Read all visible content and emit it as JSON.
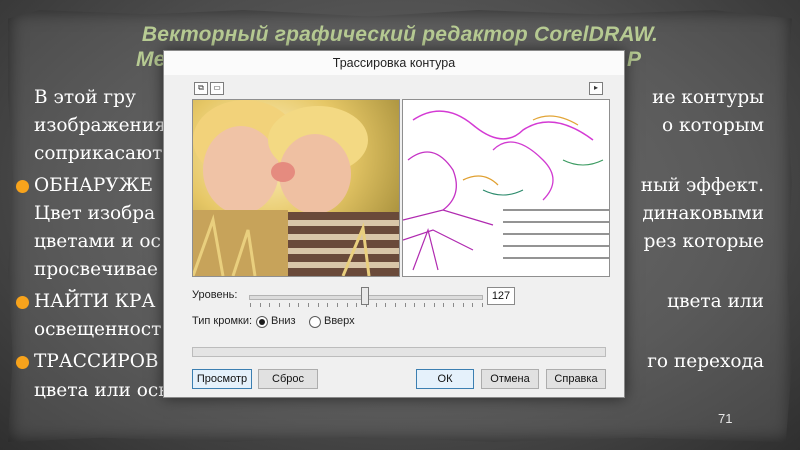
{
  "slide": {
    "title_line1": "Векторный графический редактор CorelDRAW.",
    "title_line2": "Ме",
    "title_line2_right": "Р",
    "page_number": "71",
    "body_lines": [
      {
        "left": "В  этой  гру",
        "right": "ие  контуры"
      },
      {
        "left": "изображения",
        "right": "о  которым"
      },
      {
        "left": "соприкасаютс",
        "right": ""
      },
      {
        "left": "ОБНАРУЖЕ",
        "right": "ный  эффект."
      },
      {
        "left": "Цвет изобра",
        "right": "динаковыми"
      },
      {
        "left": "цветами и ос",
        "right": "рез  которые"
      },
      {
        "left": "просвечивае",
        "right": ""
      },
      {
        "left": "НАЙТИ  КРА",
        "right": "цвета  или"
      },
      {
        "left": "освещенност",
        "right": ""
      },
      {
        "left": "ТРАССИРОВ",
        "right": "го  перехода"
      },
      {
        "left": "цвета или осв",
        "right": ""
      }
    ],
    "colors": {
      "title": "#b7cb93",
      "bullet": "#f7a31c",
      "text": "#ffffff"
    }
  },
  "dialog": {
    "title": "Трассировка контура",
    "level_label": "Уровень:",
    "level_value": "127",
    "level_fraction": 0.5,
    "edge_type_label": "Тип кромки:",
    "radio_down": "Вниз",
    "radio_up": "Вверх",
    "selected_edge": "Вниз",
    "buttons": {
      "preview": "Просмотр",
      "reset": "Сброс",
      "ok": "ОК",
      "cancel": "Отмена",
      "help": "Справка"
    },
    "icons": {
      "toolbar_left_1": "side-by-side-view-icon",
      "toolbar_left_2": "single-view-icon",
      "toolbar_right": "expand-arrow-icon"
    }
  }
}
